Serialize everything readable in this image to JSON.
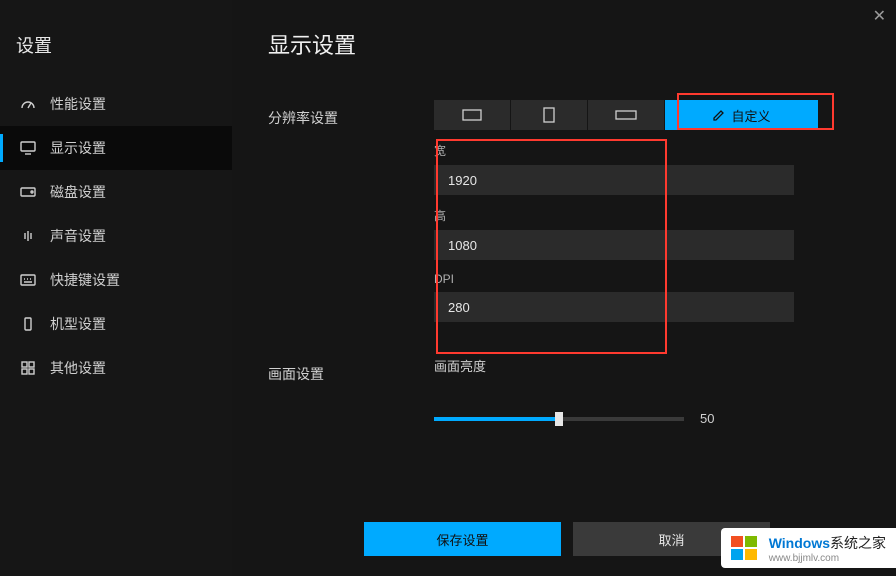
{
  "window": {
    "title": "设置"
  },
  "sidebar": {
    "items": [
      {
        "label": "性能设置"
      },
      {
        "label": "显示设置"
      },
      {
        "label": "磁盘设置"
      },
      {
        "label": "声音设置"
      },
      {
        "label": "快捷键设置"
      },
      {
        "label": "机型设置"
      },
      {
        "label": "其他设置"
      }
    ]
  },
  "main": {
    "title": "显示设置",
    "resolution": {
      "label": "分辨率设置",
      "custom_tab": "自定义",
      "width_label": "宽",
      "width_value": "1920",
      "height_label": "高",
      "height_value": "1080",
      "dpi_label": "DPI",
      "dpi_value": "280"
    },
    "picture": {
      "label": "画面设置",
      "brightness_label": "画面亮度",
      "brightness_value": "50"
    }
  },
  "footer": {
    "save": "保存设置",
    "cancel": "取消"
  },
  "watermark": {
    "brand": "Windows",
    "suffix": "系统之家",
    "url": "www.bjjmlv.com"
  }
}
